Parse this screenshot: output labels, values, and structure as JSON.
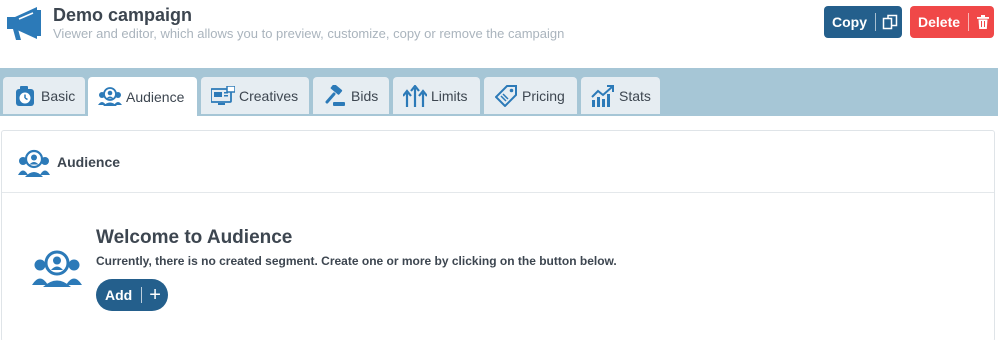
{
  "header": {
    "title": "Demo campaign",
    "subtitle": "Viewer and editor, which allows you to preview, customize, copy or remove the campaign",
    "logo_icon": "megaphone-icon"
  },
  "actions": {
    "copy_label": "Copy",
    "copy_icon": "copy-icon",
    "delete_label": "Delete",
    "delete_icon": "trash-icon"
  },
  "tabs": [
    {
      "label": "Basic",
      "icon": "stopwatch-icon",
      "active": false
    },
    {
      "label": "Audience",
      "icon": "audience-icon",
      "active": true
    },
    {
      "label": "Creatives",
      "icon": "creatives-icon",
      "active": false
    },
    {
      "label": "Bids",
      "icon": "gavel-icon",
      "active": false
    },
    {
      "label": "Limits",
      "icon": "arrows-up-icon",
      "active": false
    },
    {
      "label": "Pricing",
      "icon": "price-tag-icon",
      "active": false
    },
    {
      "label": "Stats",
      "icon": "chart-icon",
      "active": false
    }
  ],
  "panel": {
    "title": "Audience",
    "welcome_title": "Welcome to Audience",
    "welcome_text": "Currently, there is no created segment. Create one or more by clicking on the button below.",
    "add_label": "Add",
    "add_icon": "plus-icon"
  },
  "colors": {
    "primary": "#245f8c",
    "danger": "#f04848",
    "tabbar": "#a6c6d6",
    "icon_blue": "#2c7ab8"
  }
}
